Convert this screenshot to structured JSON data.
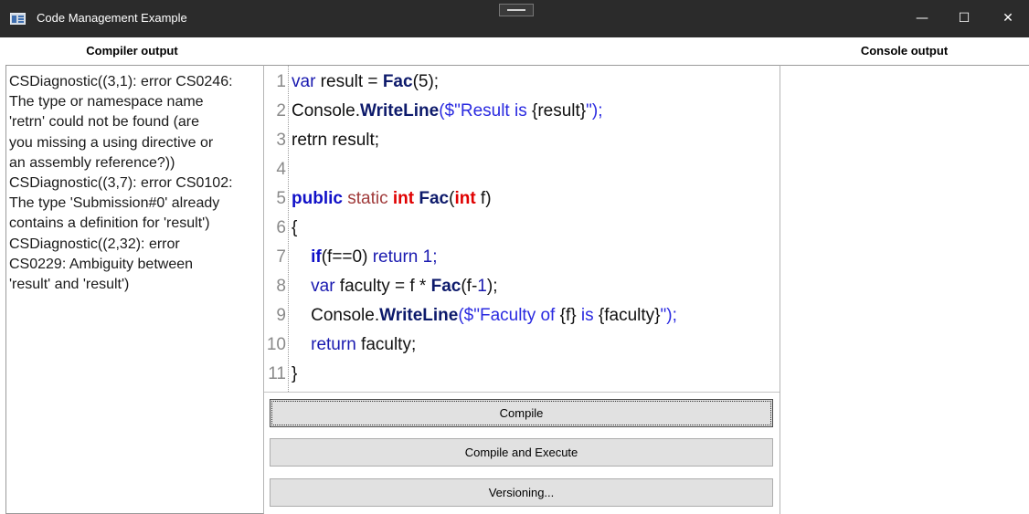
{
  "window": {
    "title": "Code Management Example",
    "minimize_glyph": "—",
    "maximize_glyph": "☐",
    "close_glyph": "✕"
  },
  "headers": {
    "compiler_output": "Compiler output",
    "console_output": "Console output"
  },
  "compiler_output": {
    "lines": [
      "CSDiagnostic((3,1): error CS0246:",
      "The type or namespace name",
      "'retrn' could not be found (are",
      "you missing a using directive or",
      "an assembly reference?))",
      "CSDiagnostic((3,7): error CS0102:",
      "The type 'Submission#0' already",
      "contains a definition for 'result')",
      "CSDiagnostic((2,32): error",
      "CS0229: Ambiguity between",
      "'result' and 'result')"
    ]
  },
  "editor": {
    "line_numbers": [
      "1",
      "2",
      "3",
      "4",
      "5",
      "6",
      "7",
      "8",
      "9",
      "10",
      "11"
    ],
    "code": {
      "l1": {
        "a": "var",
        "b": " result = ",
        "c": "Fac",
        "d": "(5);"
      },
      "l2": {
        "a": "Console.",
        "b": "WriteLine",
        "c": "($\"Result is ",
        "d": "{result}",
        "e": "\");"
      },
      "l3": {
        "a": "retrn result;"
      },
      "l5": {
        "a": "public",
        "b": " static ",
        "c": "int",
        "d": " Fac",
        "e": "(",
        "f": "int",
        "g": " f)"
      },
      "l6": {
        "a": "{"
      },
      "l7": {
        "a": "    ",
        "b": "if",
        "c": "(f==0) ",
        "d": "return 1;"
      },
      "l8": {
        "a": "    ",
        "b": "var",
        "c": " faculty = f * ",
        "d": "Fac",
        "e": "(f-",
        "f": "1",
        "g": ");"
      },
      "l9": {
        "a": "    Console.",
        "b": "WriteLine",
        "c": "($\"Faculty of ",
        "d": "{f}",
        "e": " is ",
        "f": "{faculty}",
        "g": "\");"
      },
      "l10": {
        "a": "    ",
        "b": "return",
        "c": " faculty;"
      },
      "l11": {
        "a": "}"
      }
    }
  },
  "buttons": {
    "compile": "Compile",
    "compile_and_execute": "Compile and Execute",
    "versioning": "Versioning..."
  },
  "console_output": {
    "text": ""
  },
  "colors": {
    "titlebar": "#2b2b2b",
    "keyword": "#1010c8",
    "type_keyword": "#e00000",
    "method": "#0d1a6b",
    "string": "#2a2ae0",
    "button_face": "#e1e1e1"
  }
}
